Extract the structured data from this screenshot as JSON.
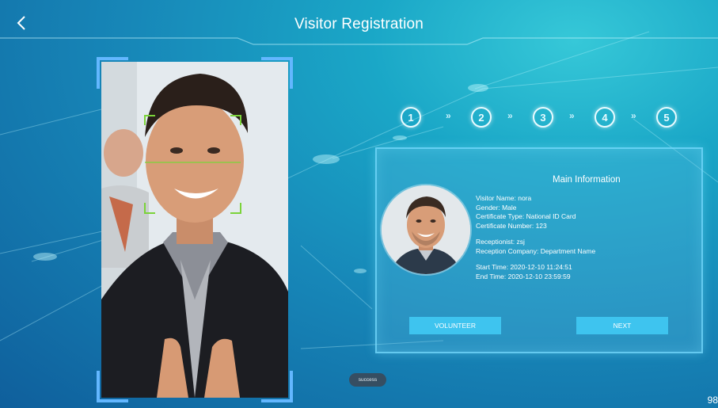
{
  "header": {
    "title": "Visitor Registration",
    "back_icon": "chevron-left-icon"
  },
  "steps": [
    "1",
    "2",
    "3",
    "4",
    "5"
  ],
  "step_separator": "»",
  "panel": {
    "title": "Main Information",
    "visitor_name": "Visitor Name: nora",
    "gender": "Gender: Male",
    "certificate_type": "Certificate Type: National ID Card",
    "certificate_number": "Certificate Number: 123",
    "receptionist": "Receptionist: zsj",
    "reception_company": "Reception Company: Department Name",
    "start_time": "Start Time: 2020-12-10 11:24:51",
    "end_time": "End Time: 2020-12-10 23:59:59",
    "volunteer_label": "VOLUNTEER",
    "next_label": "NEXT"
  },
  "toast": "success",
  "corner_number": "98",
  "colors": {
    "accent_blue": "#3ec4ef",
    "frame_corner": "#63b7ff",
    "face_box": "#7bd33a"
  }
}
